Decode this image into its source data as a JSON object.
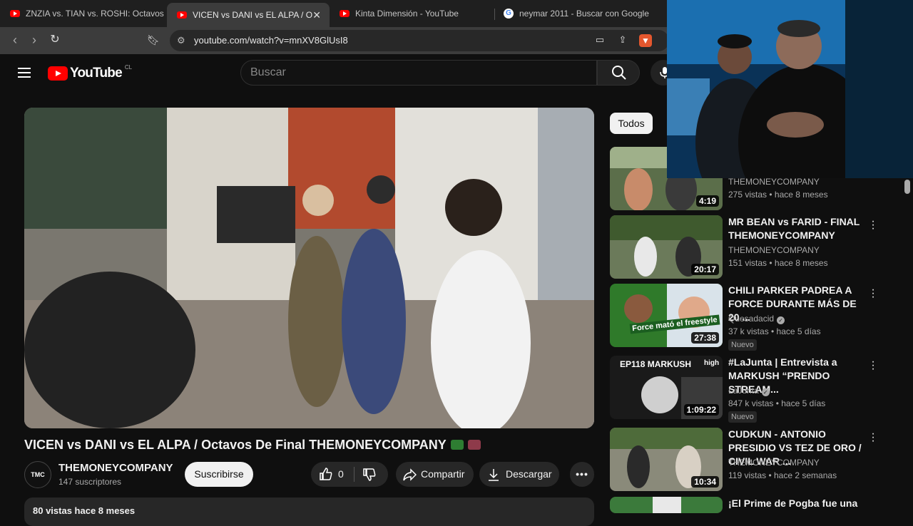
{
  "browser": {
    "tabs": [
      {
        "label": "ZNZIA vs. TIAN vs. ROSHI: Octavos -",
        "icon": "youtube-icon",
        "active": false
      },
      {
        "label": "VICEN vs DANI vs EL ALPA / Octa",
        "icon": "youtube-icon",
        "active": true
      },
      {
        "label": "Kinta Dimensión - YouTube",
        "icon": "youtube-icon",
        "active": false
      },
      {
        "label": "neymar 2011 - Buscar con Google",
        "icon": "google-icon",
        "active": false
      }
    ],
    "url": "youtube.com/watch?v=mnXV8GlUsI8"
  },
  "youtube": {
    "logo_text": "YouTube",
    "country_code": "CL",
    "search_placeholder": "Buscar"
  },
  "video": {
    "title": "VICEN vs DANI vs EL ALPA / Octavos De Final THEMONEYCOMPANY",
    "channel": "THEMONEYCOMPANY",
    "channel_avatar_text": "TMC",
    "subscribers": "147 suscriptores",
    "subscribe_label": "Suscribirse",
    "likes": "0",
    "share_label": "Compartir",
    "download_label": "Descargar",
    "more_label": "•••",
    "description_preview": "80 vistas  hace 8 meses"
  },
  "sidebar": {
    "chips": [
      "Todos"
    ],
    "recommendations": [
      {
        "title": "",
        "channel": "THEMONEYCOMPANY",
        "meta": "275 vistas • hace 8 meses",
        "duration": "4:19",
        "verified": false,
        "new": false
      },
      {
        "title": "MR BEAN vs FARID - FINAL THEMONEYCOMPANY",
        "channel": "THEMONEYCOMPANY",
        "meta": "151 vistas • hace 8 meses",
        "duration": "20:17",
        "verified": false,
        "new": false
      },
      {
        "title": "CHILI PARKER PADREA A FORCE DURANTE MÁS DE 20 ...",
        "channel": "Quesadacid",
        "meta": "37 k vistas • hace 5 días",
        "duration": "27:38",
        "verified": true,
        "new": true,
        "thumb_text": "Force mató el freestyle"
      },
      {
        "title": "#LaJunta | Entrevista a MARKUSH “PRENDO STREAM...",
        "channel": "LaJunta",
        "meta": "847 k vistas • hace 5 días",
        "duration": "1:09:22",
        "verified": true,
        "new": true,
        "thumb_text": "EP118 MARKUSH",
        "thumb_tag": "high"
      },
      {
        "title": "CUDKUN - ANTONIO PRESIDIO VS TEZ DE ORO / CIVIL WAR ...",
        "channel": "THEMONEYCOMPANY",
        "meta": "119 vistas • hace 2 semanas",
        "duration": "10:34",
        "verified": false,
        "new": false
      },
      {
        "title": "¡El Prime de Pogba fue una",
        "channel": "",
        "meta": "",
        "duration": "",
        "verified": false,
        "new": false
      }
    ],
    "new_badge": "Nuevo"
  },
  "colors": {
    "background": "#0f0f0f",
    "youtube_red": "#ff0000",
    "chip_active": "#f1f1f1",
    "pill_bg": "#272727"
  }
}
